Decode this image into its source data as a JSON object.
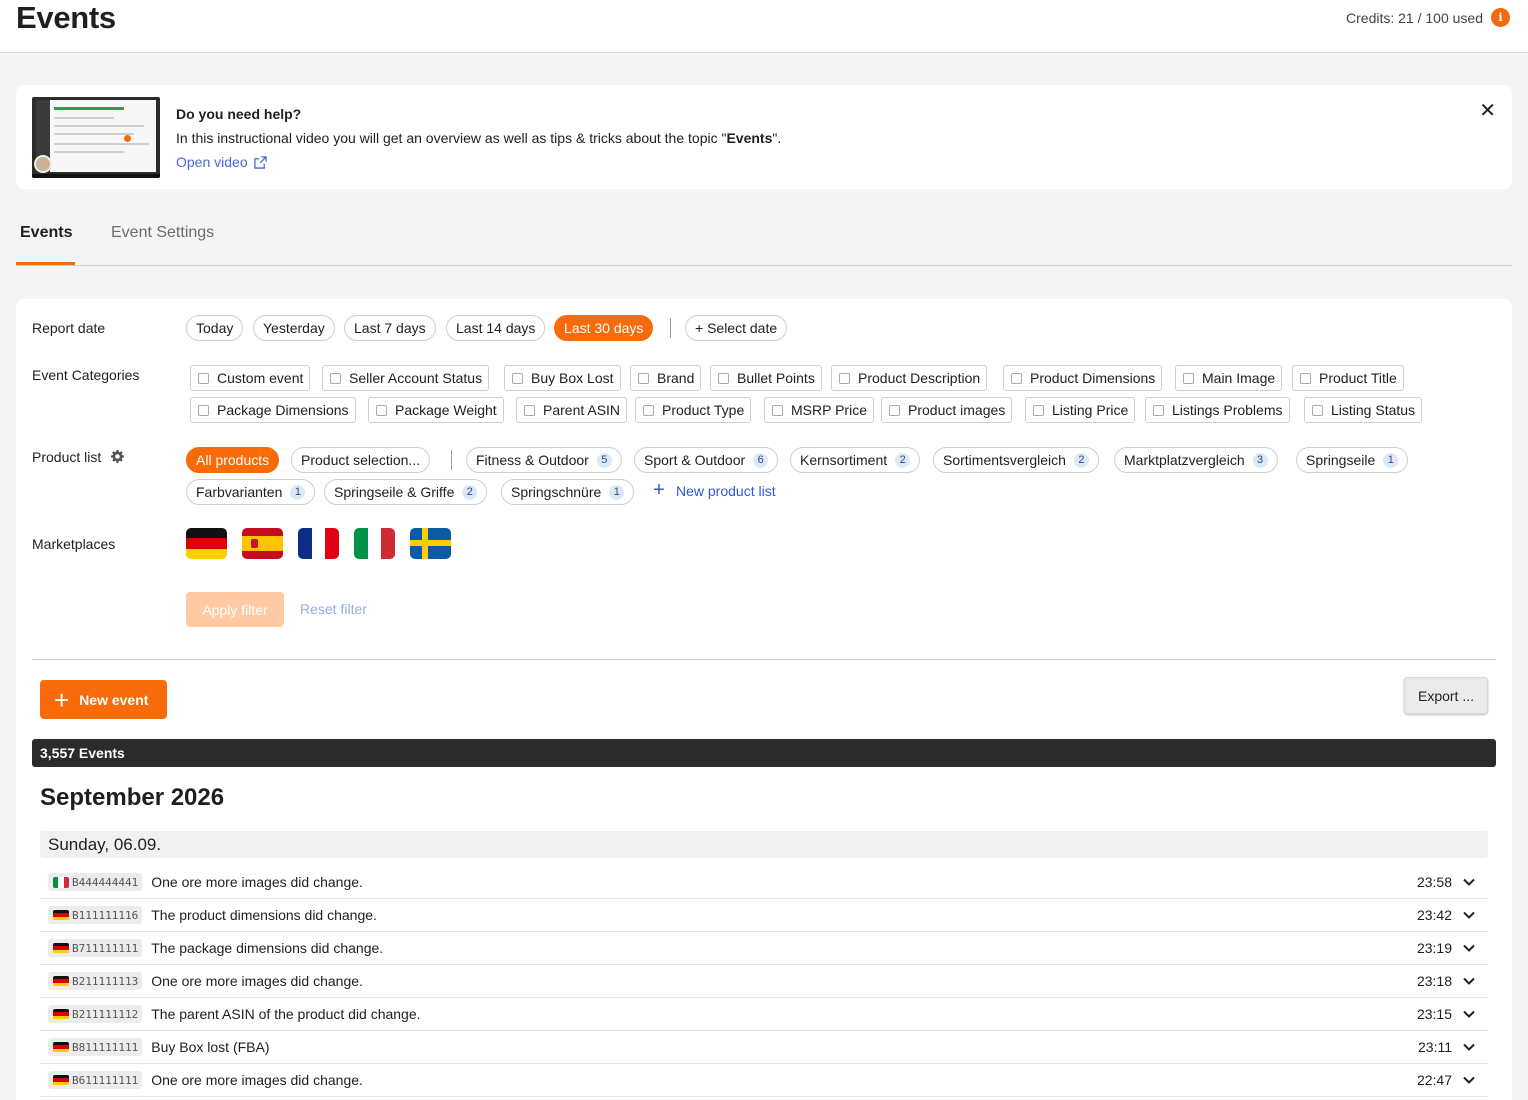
{
  "header": {
    "title": "Events",
    "credits": "Credits: 21 / 100 used",
    "info_glyph": "i"
  },
  "help": {
    "title": "Do you need help?",
    "text_before": "In this instructional video you will get an overview as well as tips & tricks about the topic \"",
    "text_bold": "Events",
    "text_after": "\".",
    "link": "Open video",
    "close_glyph": "✕"
  },
  "tabs": [
    {
      "label": "Events",
      "active": true
    },
    {
      "label": "Event Settings",
      "active": false
    }
  ],
  "filters": {
    "report_date_label": "Report date",
    "dates": [
      "Today",
      "Yesterday",
      "Last 7 days",
      "Last 14 days",
      "Last 30 days"
    ],
    "active_date": "Last 30 days",
    "select_date": "+ Select date",
    "categories_label": "Event Categories",
    "categories": [
      "Custom event",
      "Seller Account Status",
      "Buy Box Lost",
      "Brand",
      "Bullet Points",
      "Product Description",
      "Product Dimensions",
      "Main Image",
      "Product Title",
      "Package Dimensions",
      "Package Weight",
      "Parent ASIN",
      "Product Type",
      "MSRP Price",
      "Product images",
      "Listing Price",
      "Listings Problems",
      "Listing Status"
    ],
    "product_list_label": "Product list",
    "all_products": "All products",
    "product_selection": "Product selection...",
    "lists": [
      {
        "name": "Fitness & Outdoor",
        "count": "5"
      },
      {
        "name": "Sport & Outdoor",
        "count": "6"
      },
      {
        "name": "Kernsortiment",
        "count": "2"
      },
      {
        "name": "Sortimentsvergleich",
        "count": "2"
      },
      {
        "name": "Marktplatzvergleich",
        "count": "3"
      },
      {
        "name": "Springseile",
        "count": "1"
      },
      {
        "name": "Farbvarianten",
        "count": "1"
      },
      {
        "name": "Springseile & Griffe",
        "count": "2"
      },
      {
        "name": "Springschnüre",
        "count": "1"
      }
    ],
    "new_product_list": "New product list",
    "marketplaces_label": "Marketplaces",
    "marketplaces": [
      "DE",
      "ES",
      "FR",
      "IT",
      "SE"
    ],
    "apply": "Apply filter",
    "reset": "Reset filter"
  },
  "actions": {
    "new_event": "New event",
    "export": "Export ..."
  },
  "events_count": "3,557 Events",
  "month": "September 2026",
  "day": "Sunday, 06.09.",
  "events": [
    {
      "flag": "IT",
      "asin": "B444444441",
      "text": "One ore more images did change.",
      "time": "23:58"
    },
    {
      "flag": "DE",
      "asin": "B111111116",
      "text": "The product dimensions did change.",
      "time": "23:42"
    },
    {
      "flag": "DE",
      "asin": "B711111111",
      "text": "The package dimensions did change.",
      "time": "23:19"
    },
    {
      "flag": "DE",
      "asin": "B211111113",
      "text": "One ore more images did change.",
      "time": "23:18"
    },
    {
      "flag": "DE",
      "asin": "B211111112",
      "text": "The parent ASIN of the product did change.",
      "time": "23:15"
    },
    {
      "flag": "DE",
      "asin": "B811111111",
      "text": "Buy Box lost (FBA)",
      "time": "23:11"
    },
    {
      "flag": "DE",
      "asin": "B611111111",
      "text": "One ore more images did change.",
      "time": "22:47"
    }
  ],
  "colors": {
    "accent": "#f76b0b",
    "link": "#2f57d8",
    "dark_bar": "#2b2b2b"
  }
}
